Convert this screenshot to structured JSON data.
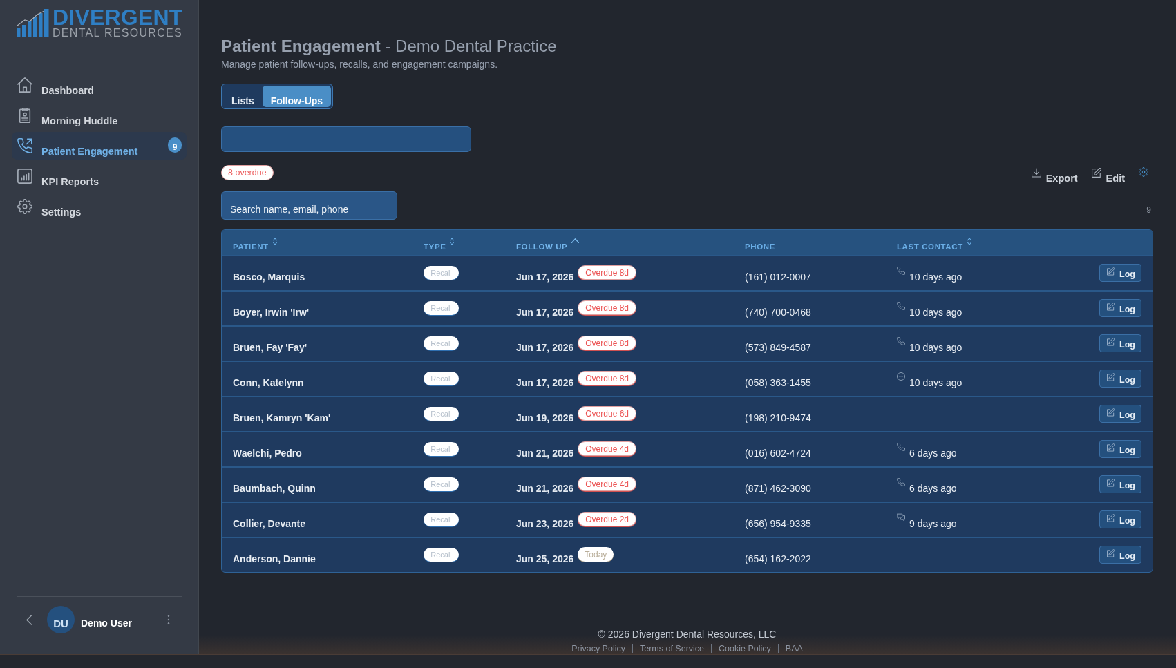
{
  "sidebar": {
    "logo": {
      "name": "DIVERGENT",
      "tagline": "DENTAL RESOURCES"
    },
    "items": [
      {
        "label": "Dashboard",
        "selected": false
      },
      {
        "label": "Morning Huddle",
        "selected": false
      },
      {
        "label": "Patient Engagement",
        "selected": true,
        "badge": "9"
      },
      {
        "label": "KPI Reports",
        "selected": false
      },
      {
        "label": "Settings",
        "selected": false
      }
    ],
    "user": {
      "initials": "DU",
      "name": "Demo User"
    }
  },
  "header": {
    "title": "**Patient Engagement** - Demo Dental Practice",
    "subtitle": "Manage patient follow-ups, recalls, and engagement campaigns."
  },
  "tabs": [
    {
      "label": "Lists",
      "selected": false
    },
    {
      "label": "Follow-Ups",
      "selected": true
    }
  ],
  "filters": {
    "overdue_badge": "8 overdue",
    "search": {
      "placeholder": "Search name, email, phone"
    },
    "count": "9"
  },
  "actions": [
    {
      "kind": "export",
      "label": "Export"
    },
    {
      "kind": "edit",
      "label": "Edit"
    },
    {
      "kind": "settings"
    }
  ],
  "table": {
    "columns": [
      {
        "label": "PATIENT",
        "sortable": true,
        "sorted": false
      },
      {
        "label": "TYPE",
        "sortable": true,
        "sorted": false
      },
      {
        "label": "FOLLOW UP",
        "sortable": true,
        "sorted": true
      },
      {
        "label": "PHONE",
        "sortable": false
      },
      {
        "label": "LAST CONTACT",
        "sortable": true,
        "sorted": false
      }
    ],
    "rows": [
      {
        "patient": "Bosco, Marquis",
        "type": "Recall",
        "follow_up": "Jun 17, 2026",
        "status": {
          "kind": "overdue",
          "label": "Overdue 8d"
        },
        "phone": "(161) 012-0007",
        "last_contact": {
          "kind": "call",
          "text": "10 days ago"
        },
        "action": "Log"
      },
      {
        "patient": "Boyer, Irwin 'Irw'",
        "type": "Recall",
        "follow_up": "Jun 17, 2026",
        "status": {
          "kind": "overdue",
          "label": "Overdue 8d"
        },
        "phone": "(740) 700-0468",
        "last_contact": {
          "kind": "call",
          "text": "10 days ago"
        },
        "action": "Log"
      },
      {
        "patient": "Bruen, Fay 'Fay'",
        "type": "Recall",
        "follow_up": "Jun 17, 2026",
        "status": {
          "kind": "overdue",
          "label": "Overdue 8d"
        },
        "phone": "(573) 849-4587",
        "last_contact": {
          "kind": "call",
          "text": "10 days ago"
        },
        "action": "Log"
      },
      {
        "patient": "Conn, Katelynn",
        "type": "Recall",
        "follow_up": "Jun 17, 2026",
        "status": {
          "kind": "overdue",
          "label": "Overdue 8d"
        },
        "phone": "(058) 363-1455",
        "last_contact": {
          "kind": "chat",
          "text": "10 days ago"
        },
        "action": "Log"
      },
      {
        "patient": "Bruen, Kamryn 'Kam'",
        "type": "Recall",
        "follow_up": "Jun 19, 2026",
        "status": {
          "kind": "overdue",
          "label": "Overdue 6d"
        },
        "phone": "(198) 210-9474",
        "last_contact": {
          "kind": "none",
          "text": "—"
        },
        "action": "Log"
      },
      {
        "patient": "Waelchi, Pedro",
        "type": "Recall",
        "follow_up": "Jun 21, 2026",
        "status": {
          "kind": "overdue",
          "label": "Overdue 4d"
        },
        "phone": "(016) 602-4724",
        "last_contact": {
          "kind": "call",
          "text": "6 days ago"
        },
        "action": "Log"
      },
      {
        "patient": "Baumbach, Quinn",
        "type": "Recall",
        "follow_up": "Jun 21, 2026",
        "status": {
          "kind": "overdue",
          "label": "Overdue 4d"
        },
        "phone": "(871) 462-3090",
        "last_contact": {
          "kind": "call",
          "text": "6 days ago"
        },
        "action": "Log"
      },
      {
        "patient": "Collier, Devante",
        "type": "Recall",
        "follow_up": "Jun 23, 2026",
        "status": {
          "kind": "overdue",
          "label": "Overdue 2d"
        },
        "phone": "(656) 954-9335",
        "last_contact": {
          "kind": "sms",
          "text": "9 days ago"
        },
        "action": "Log"
      },
      {
        "patient": "Anderson, Dannie",
        "type": "Recall",
        "follow_up": "Jun 25, 2026",
        "status": {
          "kind": "today",
          "label": "Today"
        },
        "phone": "(654) 162-2022",
        "last_contact": {
          "kind": "none",
          "text": "—"
        },
        "action": "Log"
      }
    ]
  },
  "footer": {
    "copyright": "© 2026 Divergent Dental Resources, LLC",
    "links": [
      "Privacy Policy",
      "Terms of Service",
      "Cookie Policy",
      "BAA"
    ]
  }
}
